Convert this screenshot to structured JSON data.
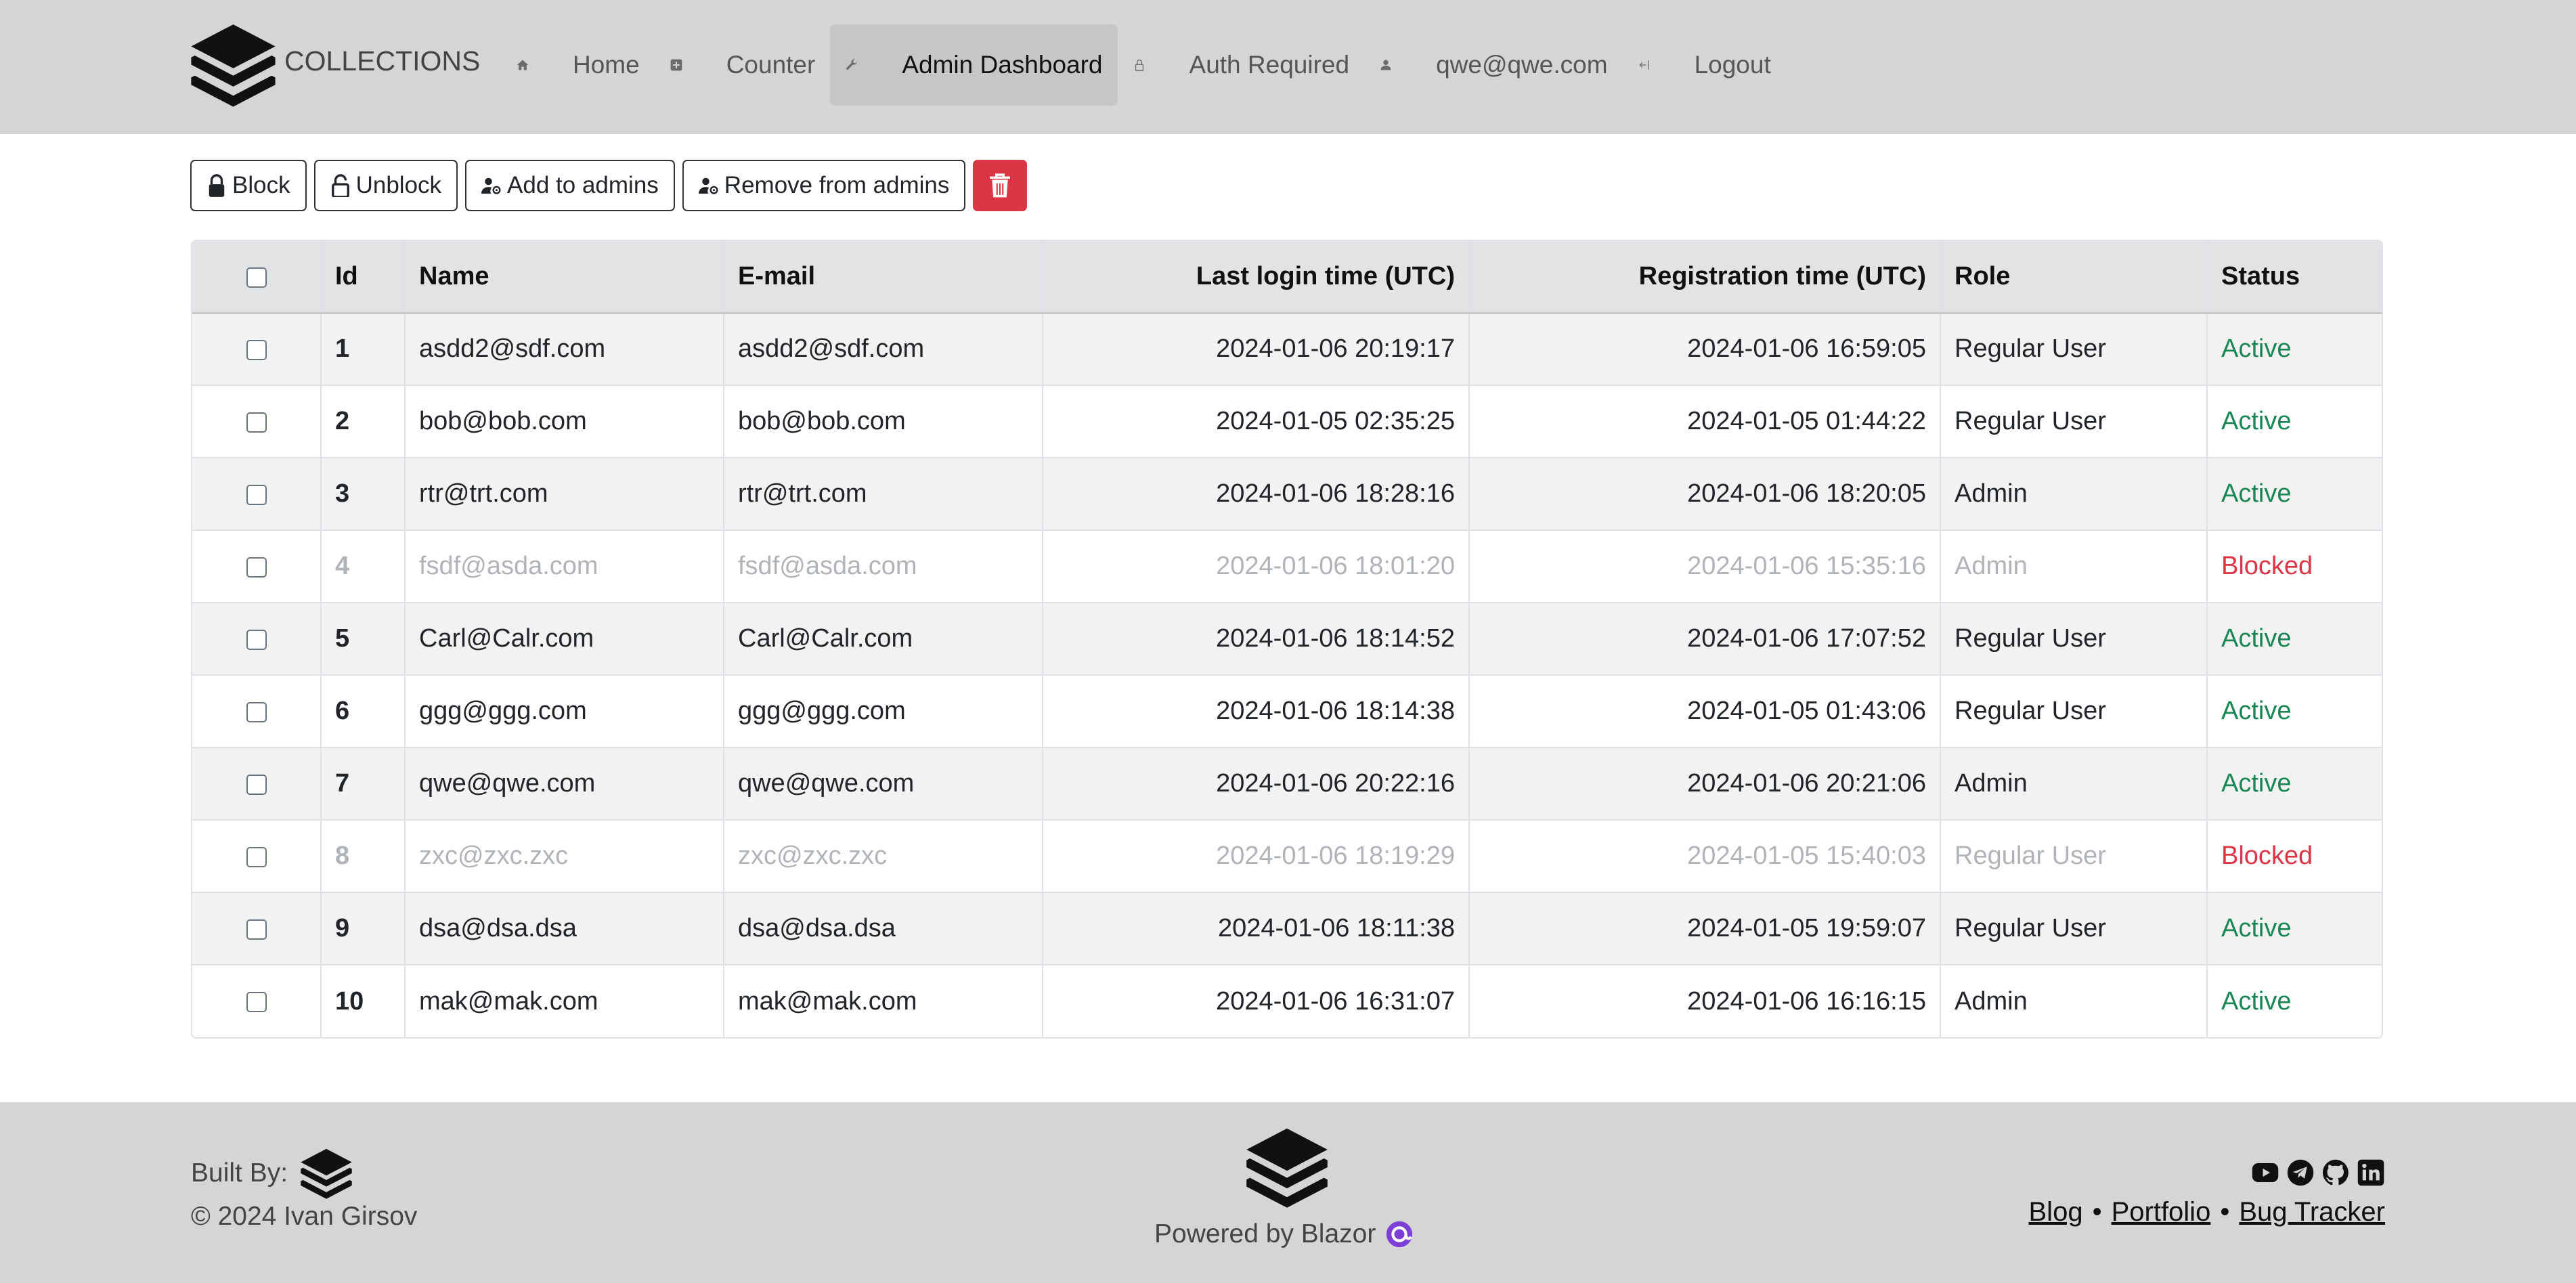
{
  "brand": {
    "name": "COLLECTIONS"
  },
  "nav": {
    "items": [
      {
        "label": "Home",
        "icon": "home-icon"
      },
      {
        "label": "Counter",
        "icon": "plus-square-icon"
      },
      {
        "label": "Admin Dashboard",
        "icon": "wrench-icon",
        "active": true
      },
      {
        "label": "Auth Required",
        "icon": "lock-icon"
      },
      {
        "label": "qwe@qwe.com",
        "icon": "person-icon"
      },
      {
        "label": "Logout",
        "icon": "logout-arrow-icon"
      }
    ]
  },
  "toolbar": {
    "block_label": "Block",
    "unblock_label": "Unblock",
    "add_admins_label": "Add to admins",
    "remove_admins_label": "Remove from admins",
    "delete_icon": "trash-icon"
  },
  "table": {
    "columns": [
      "Id",
      "Name",
      "E-mail",
      "Last login time (UTC)",
      "Registration time (UTC)",
      "Role",
      "Status"
    ],
    "rows": [
      {
        "id": "1",
        "name": "asdd2@sdf.com",
        "email": "asdd2@sdf.com",
        "last_login": "2024-01-06 20:19:17",
        "registered": "2024-01-06 16:59:05",
        "role": "Regular User",
        "status": "Active"
      },
      {
        "id": "2",
        "name": "bob@bob.com",
        "email": "bob@bob.com",
        "last_login": "2024-01-05 02:35:25",
        "registered": "2024-01-05 01:44:22",
        "role": "Regular User",
        "status": "Active"
      },
      {
        "id": "3",
        "name": "rtr@trt.com",
        "email": "rtr@trt.com",
        "last_login": "2024-01-06 18:28:16",
        "registered": "2024-01-06 18:20:05",
        "role": "Admin",
        "status": "Active"
      },
      {
        "id": "4",
        "name": "fsdf@asda.com",
        "email": "fsdf@asda.com",
        "last_login": "2024-01-06 18:01:20",
        "registered": "2024-01-06 15:35:16",
        "role": "Admin",
        "status": "Blocked"
      },
      {
        "id": "5",
        "name": "Carl@Calr.com",
        "email": "Carl@Calr.com",
        "last_login": "2024-01-06 18:14:52",
        "registered": "2024-01-06 17:07:52",
        "role": "Regular User",
        "status": "Active"
      },
      {
        "id": "6",
        "name": "ggg@ggg.com",
        "email": "ggg@ggg.com",
        "last_login": "2024-01-06 18:14:38",
        "registered": "2024-01-05 01:43:06",
        "role": "Regular User",
        "status": "Active"
      },
      {
        "id": "7",
        "name": "qwe@qwe.com",
        "email": "qwe@qwe.com",
        "last_login": "2024-01-06 20:22:16",
        "registered": "2024-01-06 20:21:06",
        "role": "Admin",
        "status": "Active"
      },
      {
        "id": "8",
        "name": "zxc@zxc.zxc",
        "email": "zxc@zxc.zxc",
        "last_login": "2024-01-06 18:19:29",
        "registered": "2024-01-05 15:40:03",
        "role": "Regular User",
        "status": "Blocked"
      },
      {
        "id": "9",
        "name": "dsa@dsa.dsa",
        "email": "dsa@dsa.dsa",
        "last_login": "2024-01-06 18:11:38",
        "registered": "2024-01-05 19:59:07",
        "role": "Regular User",
        "status": "Active"
      },
      {
        "id": "10",
        "name": "mak@mak.com",
        "email": "mak@mak.com",
        "last_login": "2024-01-06 16:31:07",
        "registered": "2024-01-06 16:16:15",
        "role": "Admin",
        "status": "Active"
      }
    ]
  },
  "footer": {
    "built_by_label": "Built By:",
    "copyright": "© 2024 Ivan Girsov",
    "powered_by": "Powered by Blazor",
    "links": [
      "Blog",
      "Portfolio",
      "Bug Tracker"
    ],
    "separator": "•",
    "social_icons": [
      "youtube-icon",
      "telegram-icon",
      "github-icon",
      "linkedin-icon"
    ]
  },
  "colors": {
    "header_bg": "#d5d5d5",
    "active_status": "#198754",
    "blocked_status": "#dc3545",
    "delete_button": "#dc3545"
  }
}
